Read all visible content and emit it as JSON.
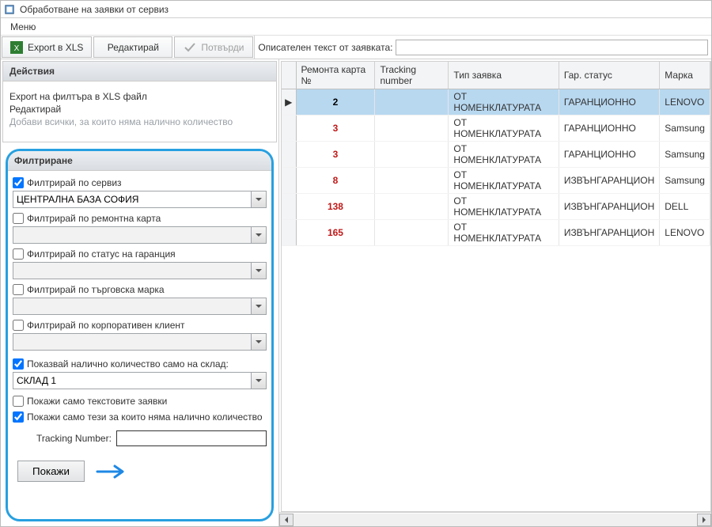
{
  "window": {
    "title": "Обработване на заявки от сервиз"
  },
  "menu": {
    "label": "Меню"
  },
  "toolbar": {
    "export_label": "Export в XLS",
    "edit_label": "Редактирай",
    "confirm_label": "Потвърди"
  },
  "description": {
    "label": "Описателен текст от заявката:",
    "value": ""
  },
  "actions": {
    "header": "Действия",
    "items": [
      {
        "label": "Export на филтъра в XLS файл",
        "disabled": false
      },
      {
        "label": "Редактирай",
        "disabled": false
      },
      {
        "label": "Добави всички, за които няма налично количество",
        "disabled": true
      }
    ]
  },
  "filter": {
    "header": "Филтриране",
    "by_service": {
      "label": "Филтрирай по сервиз",
      "checked": true,
      "value": "ЦЕНТРАЛНА БАЗА СОФИЯ"
    },
    "by_card": {
      "label": "Филтрирай по ремонтна карта",
      "checked": false,
      "value": ""
    },
    "by_warranty": {
      "label": "Филтрирай по статус на гаранция",
      "checked": false,
      "value": ""
    },
    "by_brand": {
      "label": "Филтрирай по търговска марка",
      "checked": false,
      "value": ""
    },
    "by_corp": {
      "label": "Филтрирай по корпоративен клиент",
      "checked": false,
      "value": ""
    },
    "by_stock": {
      "label": "Показвай налично количество само на склад:",
      "checked": true,
      "value": "СКЛАД 1"
    },
    "text_only": {
      "label": "Покажи само текстовите заявки",
      "checked": false
    },
    "no_qty": {
      "label": "Покажи само тези за които няма налично количество",
      "checked": true
    },
    "tracking": {
      "label": "Tracking Number:",
      "value": ""
    },
    "show_button": "Покажи"
  },
  "grid": {
    "columns": [
      "Ремонта карта №",
      "Tracking number",
      "Тип заявка",
      "Гар. статус",
      "Марка"
    ],
    "rows": [
      {
        "card": "2",
        "tracking": "",
        "type": "ОТ НОМЕНКЛАТУРАТА",
        "warranty": "ГАРАНЦИОННО",
        "brand": "LENOVO",
        "selected": true
      },
      {
        "card": "3",
        "tracking": "",
        "type": "ОТ НОМЕНКЛАТУРАТА",
        "warranty": "ГАРАНЦИОННО",
        "brand": "Samsung",
        "selected": false
      },
      {
        "card": "3",
        "tracking": "",
        "type": "ОТ НОМЕНКЛАТУРАТА",
        "warranty": "ГАРАНЦИОННО",
        "brand": "Samsung",
        "selected": false
      },
      {
        "card": "8",
        "tracking": "",
        "type": "ОТ НОМЕНКЛАТУРАТА",
        "warranty": "ИЗВЪНГАРАНЦИОН",
        "brand": "Samsung",
        "selected": false
      },
      {
        "card": "138",
        "tracking": "",
        "type": "ОТ НОМЕНКЛАТУРАТА",
        "warranty": "ИЗВЪНГАРАНЦИОН",
        "brand": "DELL",
        "selected": false
      },
      {
        "card": "165",
        "tracking": "",
        "type": "ОТ НОМЕНКЛАТУРАТА",
        "warranty": "ИЗВЪНГАРАНЦИОН",
        "brand": "LENOVO",
        "selected": false
      }
    ]
  }
}
